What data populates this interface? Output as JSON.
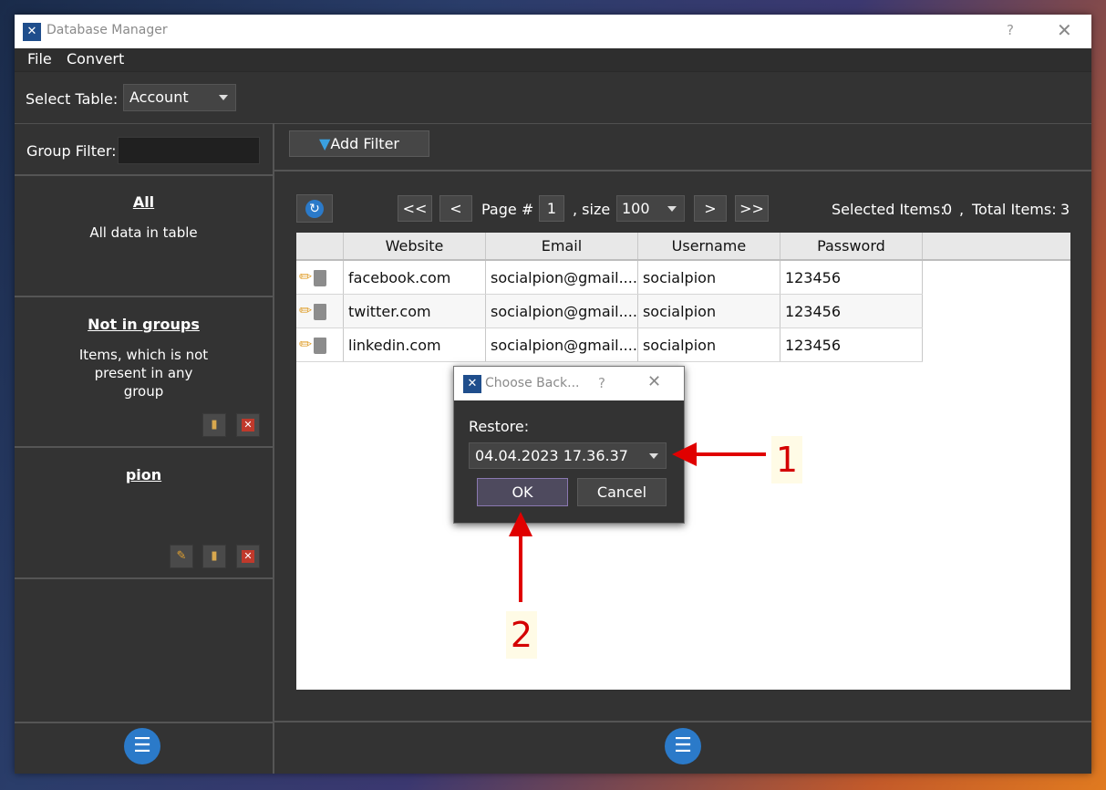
{
  "window": {
    "title": "Database Manager",
    "help": "?",
    "close": "✕",
    "icon": "app-logo-icon"
  },
  "menu": [
    "File",
    "Convert"
  ],
  "table_selector": {
    "label": "Select Table:",
    "value": "Account"
  },
  "left": {
    "group_filter_label": "Group Filter:",
    "groups": [
      {
        "title": "All",
        "description": "All data in table"
      },
      {
        "title": "Not in groups",
        "description": "Items, which is not present in any group"
      },
      {
        "title": "pion",
        "description": ""
      }
    ]
  },
  "toolbar": {
    "add_filter": "Add Filter"
  },
  "pager": {
    "first": "<<",
    "prev": "<",
    "page_label": "Page #",
    "page": "1",
    "size_label": ", size",
    "size": "100",
    "next": ">",
    "last": ">>",
    "selected_label": "Selected Items:",
    "selected": "0",
    "sep": ",",
    "total_label": "Total Items:",
    "total": "3"
  },
  "table": {
    "columns": [
      "Website",
      "Email",
      "Username",
      "Password"
    ],
    "rows": [
      [
        "facebook.com",
        "socialpion@gmail....",
        "socialpion",
        "123456"
      ],
      [
        "twitter.com",
        "socialpion@gmail....",
        "socialpion",
        "123456"
      ],
      [
        "linkedin.com",
        "socialpion@gmail....",
        "socialpion",
        "123456"
      ]
    ]
  },
  "dialog": {
    "title": "Choose Back...",
    "help": "?",
    "close": "✕",
    "restore_label": "Restore:",
    "restore_value": "04.04.2023 17.36.37",
    "ok": "OK",
    "cancel": "Cancel"
  },
  "annotations": {
    "label1": "1",
    "label2": "2",
    "color": "#e00000"
  },
  "colors": {
    "window_bg": "#333333",
    "accent_blue": "#2b7ac9",
    "arrow_red": "#e00000"
  }
}
